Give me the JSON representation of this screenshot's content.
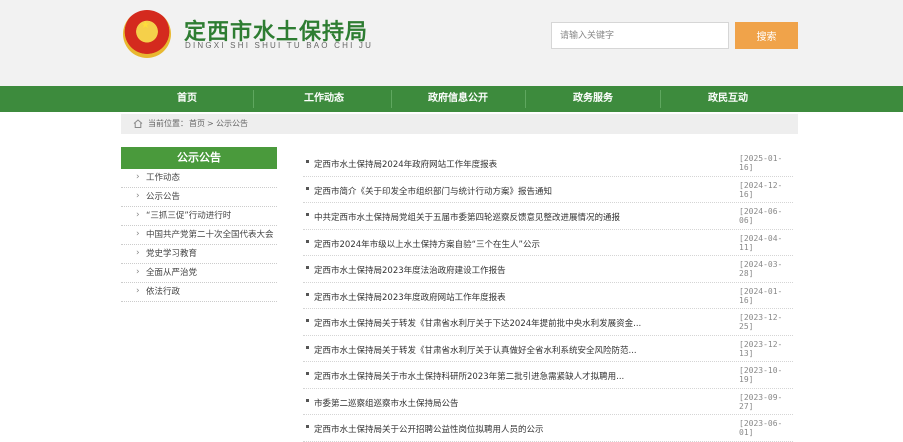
{
  "header": {
    "title_cn": "定西市水土保持局",
    "title_en": "DINGXI SHI SHUI TU BAO CHI JU",
    "search_placeholder": "请输入关键字",
    "search_button": "搜索"
  },
  "nav": {
    "items": [
      {
        "label": "首页"
      },
      {
        "label": "工作动态"
      },
      {
        "label": "政府信息公开"
      },
      {
        "label": "政务服务"
      },
      {
        "label": "政民互动"
      }
    ]
  },
  "breadcrumb": {
    "location": "当前位置：",
    "home": "首页",
    "sep": ">",
    "current": "公示公告"
  },
  "sidebar": {
    "title": "公示公告",
    "items": [
      {
        "label": "工作动态"
      },
      {
        "label": "公示公告"
      },
      {
        "label": "“三抓三促”行动进行时"
      },
      {
        "label": "中国共产党第二十次全国代表大会"
      },
      {
        "label": "党史学习教育"
      },
      {
        "label": "全面从严治党"
      },
      {
        "label": "依法行政"
      }
    ]
  },
  "news": {
    "items": [
      {
        "title": "定西市水土保持局2024年政府网站工作年度报表",
        "date": "[2025-01-16]"
      },
      {
        "title": "定西市简介《关于印发全市组织部门与统计行动方案》报告通知",
        "date": "[2024-12-16]"
      },
      {
        "title": "中共定西市水土保持局党组关于五届市委第四轮巡察反馈意见整改进展情况的通报",
        "date": "[2024-06-06]"
      },
      {
        "title": "定西市2024年市级以上水土保持方案自验“三个在生人”公示",
        "date": "[2024-04-11]"
      },
      {
        "title": "定西市水土保持局2023年度法治政府建设工作报告",
        "date": "[2024-03-28]"
      },
      {
        "title": "定西市水土保持局2023年度政府网站工作年度报表",
        "date": "[2024-01-16]"
      },
      {
        "title": "定西市水土保持局关于转发《甘肃省水利厅关于下达2024年提前批中央水利发展资金...",
        "date": "[2023-12-25]"
      },
      {
        "title": "定西市水土保持局关于转发《甘肃省水利厅关于认真做好全省水利系统安全风险防范...",
        "date": "[2023-12-13]"
      },
      {
        "title": "定西市水土保持局关于市水土保持科研所2023年第二批引进急需紧缺人才拟聘用...",
        "date": "[2023-10-19]"
      },
      {
        "title": "市委第二巡察组巡察市水土保持局公告",
        "date": "[2023-09-27]"
      },
      {
        "title": "定西市水土保持局关于公开招聘公益性岗位拟聘用人员的公示",
        "date": "[2023-06-01]"
      }
    ]
  }
}
